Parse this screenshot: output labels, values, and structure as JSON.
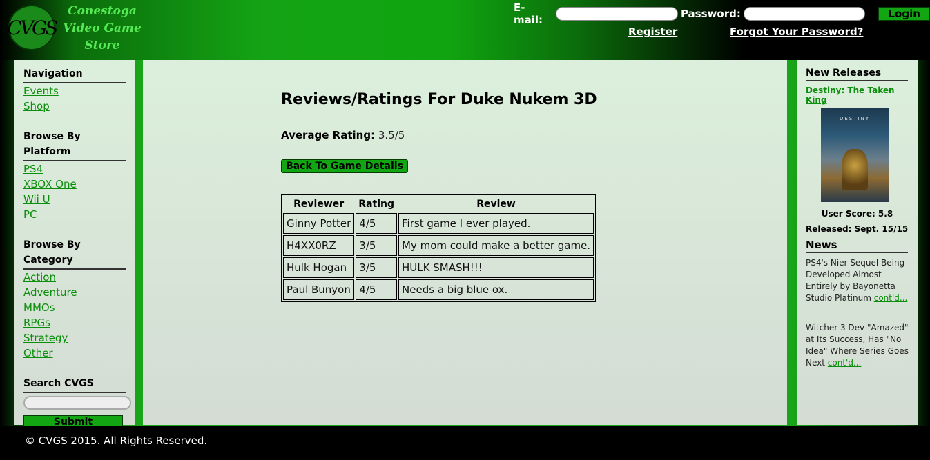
{
  "header": {
    "logo_mark": "CVGS",
    "logo_line1": "Conestoga",
    "logo_line2": "Video Game",
    "logo_line3": "Store",
    "email_label": "E-mail:",
    "password_label": "Password:",
    "login_label": "Login",
    "register_label": "Register",
    "forgot_label": "Forgot Your Password?"
  },
  "left": {
    "nav_title": "Navigation",
    "nav": [
      "Events",
      "Shop"
    ],
    "platform_title": "Browse By Platform",
    "platforms": [
      "PS4",
      "XBOX One",
      "Wii U",
      "PC"
    ],
    "category_title": "Browse By Category",
    "categories": [
      "Action",
      "Adventure",
      "MMOs",
      "RPGs",
      "Strategy",
      "Other"
    ],
    "search_title": "Search CVGS",
    "submit_label": "Submit"
  },
  "main": {
    "title": "Reviews/Ratings For Duke Nukem 3D",
    "avg_label": "Average Rating:",
    "avg_value": "3.5/5",
    "back_label": "Back To Game Details",
    "columns": [
      "Reviewer",
      "Rating",
      "Review"
    ],
    "rows": [
      [
        "Ginny Potter",
        "4/5",
        "First game I ever played."
      ],
      [
        "H4XX0RZ",
        "3/5",
        "My mom could make a better game."
      ],
      [
        "Hulk Hogan",
        "3/5",
        "HULK SMASH!!!"
      ],
      [
        "Paul Bunyon",
        "4/5",
        "Needs a big blue ox."
      ]
    ]
  },
  "right": {
    "releases_title": "New Releases",
    "release_name": "Destiny: The Taken King",
    "cover_text": "DESTINY",
    "user_score": "User Score: 5.8",
    "released": "Released: Sept. 15/15",
    "news_title": "News",
    "news": [
      {
        "text": "PS4's Nier Sequel Being Developed Almost Entirely by Bayonetta Studio Platinum ",
        "link": "cont'd..."
      },
      {
        "text": "Witcher 3 Dev \"Amazed\" at Its Success, Has \"No Idea\" Where Series Goes Next ",
        "link": "cont'd..."
      }
    ]
  },
  "footer": {
    "copyright": "© CVGS 2015. All Rights Reserved."
  }
}
